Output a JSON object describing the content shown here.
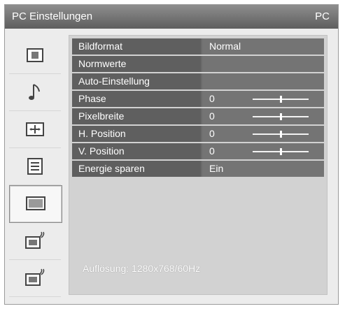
{
  "title": {
    "left": "PC Einstellungen",
    "right": "PC"
  },
  "sidebar": {
    "items": [
      {
        "icon": "picture-icon"
      },
      {
        "icon": "music-note-icon"
      },
      {
        "icon": "screen-adjust-icon"
      },
      {
        "icon": "settings-list-icon"
      },
      {
        "icon": "monitor-icon",
        "active": true
      },
      {
        "icon": "tv-antenna-icon"
      },
      {
        "icon": "tv-antenna-icon-2"
      }
    ]
  },
  "menu": {
    "rows": [
      {
        "label": "Bildformat",
        "value": "Normal"
      },
      {
        "label": "Normwerte",
        "value": ""
      },
      {
        "label": "Auto-Einstellung",
        "value": ""
      },
      {
        "label": "Phase",
        "value": "0",
        "slider": 0.5
      },
      {
        "label": "Pixelbreite",
        "value": "0",
        "slider": 0.5
      },
      {
        "label": "H. Position",
        "value": "0",
        "slider": 0.5
      },
      {
        "label": "V. Position",
        "value": "0",
        "slider": 0.5
      },
      {
        "label": "Energie sparen",
        "value": "Ein"
      }
    ]
  },
  "resolution": "Auflösung: 1280x768/60Hz"
}
